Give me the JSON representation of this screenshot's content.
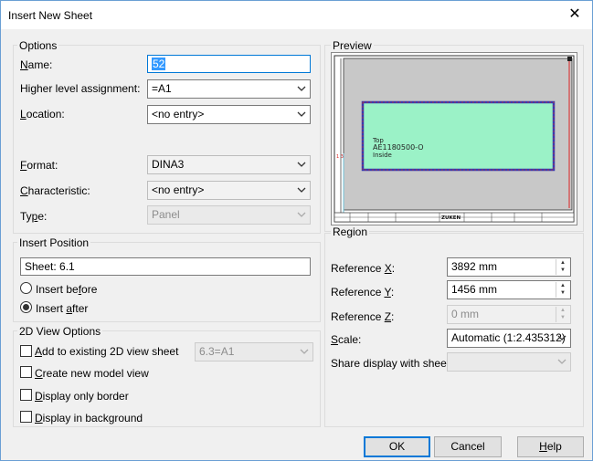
{
  "window": {
    "title": "Insert New Sheet",
    "close_glyph": "✕"
  },
  "options": {
    "group_label": "Options",
    "name": {
      "label_u": "N",
      "label_rest": "ame:",
      "value": "52"
    },
    "higher_level": {
      "label": "Higher level assignment:",
      "value": "=A1"
    },
    "location": {
      "label_u": "L",
      "label_rest": "ocation:",
      "value": "<no entry>"
    },
    "format": {
      "label_pre": "",
      "label_u": "F",
      "label_rest": "ormat:",
      "value": "DINA3"
    },
    "characteristic": {
      "label_pre": "",
      "label_u": "C",
      "label_rest": "haracteristic:",
      "value": "<no entry>"
    },
    "type": {
      "label_pre": "Ty",
      "label_u": "p",
      "label_rest": "e:",
      "value": "Panel"
    }
  },
  "insert_position": {
    "group_label": "Insert Position",
    "sheet": "Sheet: 6.1",
    "before": {
      "pre": "Insert be",
      "u": "f",
      "rest": "ore",
      "checked": false
    },
    "after": {
      "pre": "Insert ",
      "u": "a",
      "rest": "fter",
      "checked": true
    }
  },
  "view2d": {
    "group_label": "2D View Options",
    "add_existing": {
      "pre": "",
      "u": "A",
      "rest": "dd to existing 2D view sheet",
      "checked": false,
      "combo": "6.3=A1"
    },
    "create_model": {
      "pre": "",
      "u": "C",
      "rest": "reate new model view",
      "checked": false
    },
    "only_border": {
      "pre": "",
      "u": "D",
      "rest": "isplay only border",
      "checked": false
    },
    "background": {
      "pre": "",
      "u": "D",
      "rest": "isplay in background",
      "checked": false
    }
  },
  "preview": {
    "group_label": "Preview",
    "box_lines": [
      "Top",
      "AE1180500-O",
      "Inside"
    ],
    "title_block_brand": "ZUKEN"
  },
  "region": {
    "group_label": "Region",
    "ref_x": {
      "pre": "Reference ",
      "u": "X",
      "rest": ":",
      "value": "3892 mm"
    },
    "ref_y": {
      "pre": "Reference ",
      "u": "Y",
      "rest": ":",
      "value": "1456 mm"
    },
    "ref_z": {
      "pre": "Reference ",
      "u": "Z",
      "rest": ":",
      "value": "0 mm"
    },
    "scale": {
      "pre": "",
      "u": "S",
      "rest": "cale:",
      "value": "Automatic (1:2.435312)"
    },
    "share": {
      "label": "Share display with sheet:",
      "value": ""
    }
  },
  "buttons": {
    "ok": "OK",
    "cancel": "Cancel",
    "help_u": "H",
    "help_rest": "elp"
  }
}
